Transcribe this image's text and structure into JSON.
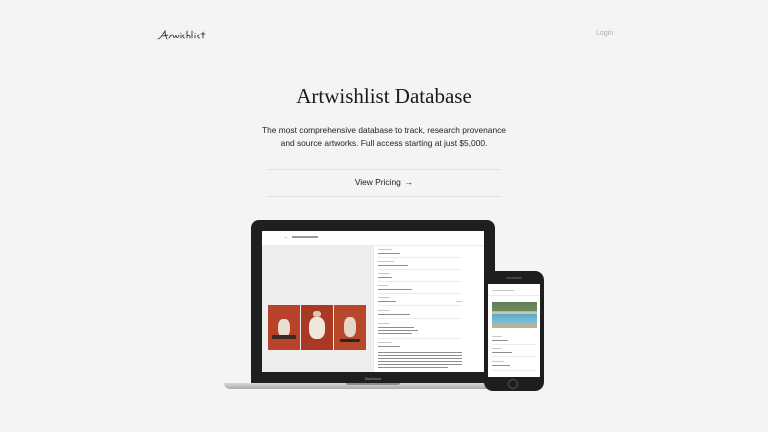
{
  "header": {
    "logo_text": "Artwishlist",
    "login_label": "Login"
  },
  "hero": {
    "title": "Artwishlist Database",
    "subtitle": "The most comprehensive database to track, research provenance and source artworks. Full access starting at just $5,000.",
    "cta_label": "View Pricing",
    "cta_arrow": "→"
  },
  "devices": {
    "laptop_label": "MacBook",
    "back_arrow": "←"
  },
  "colors": {
    "background": "#f4f4f4",
    "text": "#1a1a1a",
    "muted": "#b0b0b0",
    "device": "#1f1f1f"
  }
}
